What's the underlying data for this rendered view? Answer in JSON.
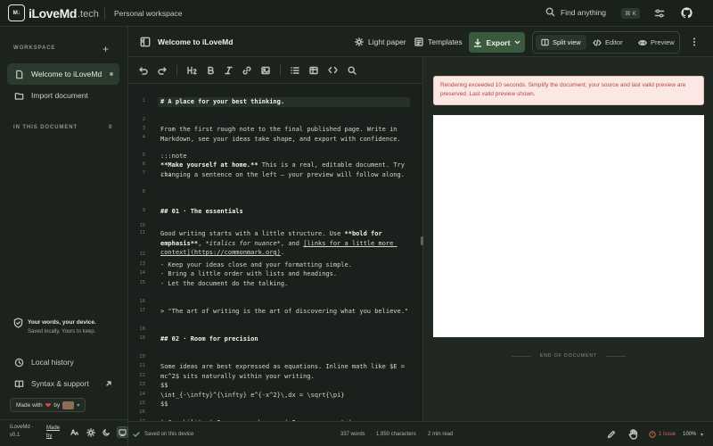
{
  "app": {
    "brand_main": "iLoveMd",
    "brand_tld": ".tech",
    "workspace": "Personal workspace",
    "logo_mark": "M↓"
  },
  "search": {
    "label": "Find anything",
    "shortcut": "⌘ K"
  },
  "sidebar": {
    "workspace_heading": "WORKSPACE",
    "items": [
      {
        "label": "Welcome to iLoveMd",
        "icon": "document-icon"
      },
      {
        "label": "Import document",
        "icon": "import-icon"
      }
    ],
    "doc_heading": "IN THIS DOCUMENT",
    "doc_count": "0",
    "device_title": "Your words, your device.",
    "device_sub": "Saved locally. Yours to keep.",
    "local_history": "Local history",
    "syntax_support": "Syntax & support",
    "made_with_prefix": "Made with",
    "made_with_by": "by",
    "version_name": "iLoveMd ·",
    "version_num": "v0.1",
    "made_by": "Made by"
  },
  "toolbar": {
    "doc_title": "Welcome to iLoveMd",
    "light_paper": "Light paper",
    "templates": "Templates",
    "export": "Export",
    "split_view": "Split view",
    "editor": "Editor",
    "preview": "Preview"
  },
  "editor_lines": [
    {
      "n": "1",
      "html": "<span class=\"b\"># A place for your best thinking.</span>"
    },
    {
      "n": "2",
      "html": ""
    },
    {
      "n": "3",
      "html": "From the first rough note to the final published page. Write in Markdown, see your ideas take shape, and export with confidence."
    },
    {
      "n": "4",
      "html": ""
    },
    {
      "n": "5",
      "html": ":::note"
    },
    {
      "n": "6",
      "html": "<span class=\"b\">**Make yourself at home.**</span> This is a real, editable document. Try changing a sentence on the left — your preview will follow along."
    },
    {
      "n": "7",
      "html": ":::"
    },
    {
      "n": "8",
      "html": ""
    },
    {
      "n": "9",
      "html": "<span class=\"b\">## 01 · The essentials</span>"
    },
    {
      "n": "10",
      "html": ""
    },
    {
      "n": "11",
      "html": "Good writing starts with a little structure. Use <span class=\"b\">**bold for emphasis**</span>, <span class=\"i\">*italics for nuance*</span>, and <span class=\"u\">[links for a little more context](https://commonmark.org)</span>."
    },
    {
      "n": "12",
      "html": ""
    },
    {
      "n": "13",
      "html": "- Keep your ideas close and your formatting simple."
    },
    {
      "n": "14",
      "html": "- Bring a little order with lists and headings."
    },
    {
      "n": "15",
      "html": "- Let the document do the talking."
    },
    {
      "n": "16",
      "html": ""
    },
    {
      "n": "17",
      "html": "> \"The art of writing is the art of discovering what you believe.\""
    },
    {
      "n": "18",
      "html": ""
    },
    {
      "n": "19",
      "html": "<span class=\"b\">## 02 · Room for precision</span>"
    },
    {
      "n": "20",
      "html": ""
    },
    {
      "n": "21",
      "html": "Some ideas are best expressed as equations. Inline math like $E = mc^2$ sits naturally within your writing."
    },
    {
      "n": "22",
      "html": ""
    },
    {
      "n": "23",
      "html": "$$"
    },
    {
      "n": "24",
      "html": "\\int_{-\\infty}^{\\infty} e^{-x^2}\\,dx = \\sqrt{\\pi}"
    },
    {
      "n": "25",
      "html": "$$"
    },
    {
      "n": "26",
      "html": ""
    },
    {
      "n": "27",
      "html": "| Capability | In your workspace | In your export |"
    }
  ],
  "preview": {
    "alert": "Rendering exceeded 10 seconds. Simplify the document; your source and last valid preview are preserved. Last valid preview shown.",
    "end_label": "END OF DOCUMENT"
  },
  "status": {
    "saved": "Saved on this device",
    "words": "337 words",
    "chars": "1,950 characters",
    "read": "2 min read",
    "issue": "1 issue",
    "zoom": "100%"
  },
  "colors": {
    "accent": "#3a5a40",
    "error": "#d06a52",
    "alert_bg": "#fbe7e3",
    "background": "#1c231d"
  }
}
